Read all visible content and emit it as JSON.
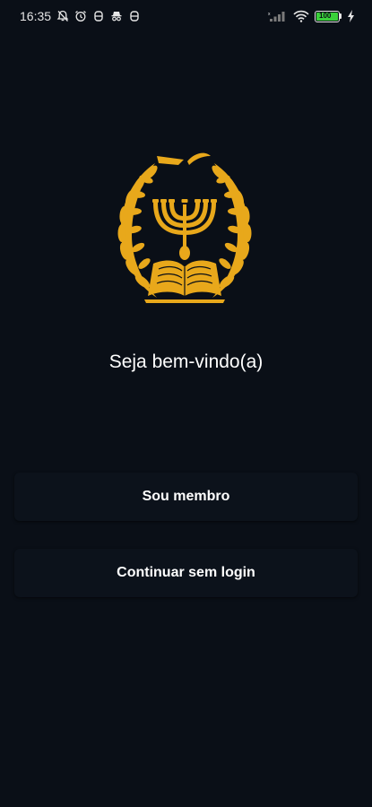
{
  "status_bar": {
    "time": "16:35",
    "left_icons": [
      "bell-off-icon",
      "alarm-icon",
      "notification-icon",
      "notification-icon",
      "incognito-icon",
      "notification-icon"
    ],
    "right_icons": [
      "signal-icon",
      "wifi-icon",
      "battery-icon",
      "charging-icon"
    ],
    "battery_level": "100",
    "battery_color": "#3ad13a"
  },
  "logo": {
    "icon": "menorah-laurel-book-logo",
    "color": "#e8a81b"
  },
  "main": {
    "welcome_text": "Seja bem-vindo(a)",
    "member_button_label": "Sou membro",
    "guest_button_label": "Continuar sem login"
  },
  "theme": {
    "background": "#0a0f17",
    "button_background": "#0c121b"
  }
}
